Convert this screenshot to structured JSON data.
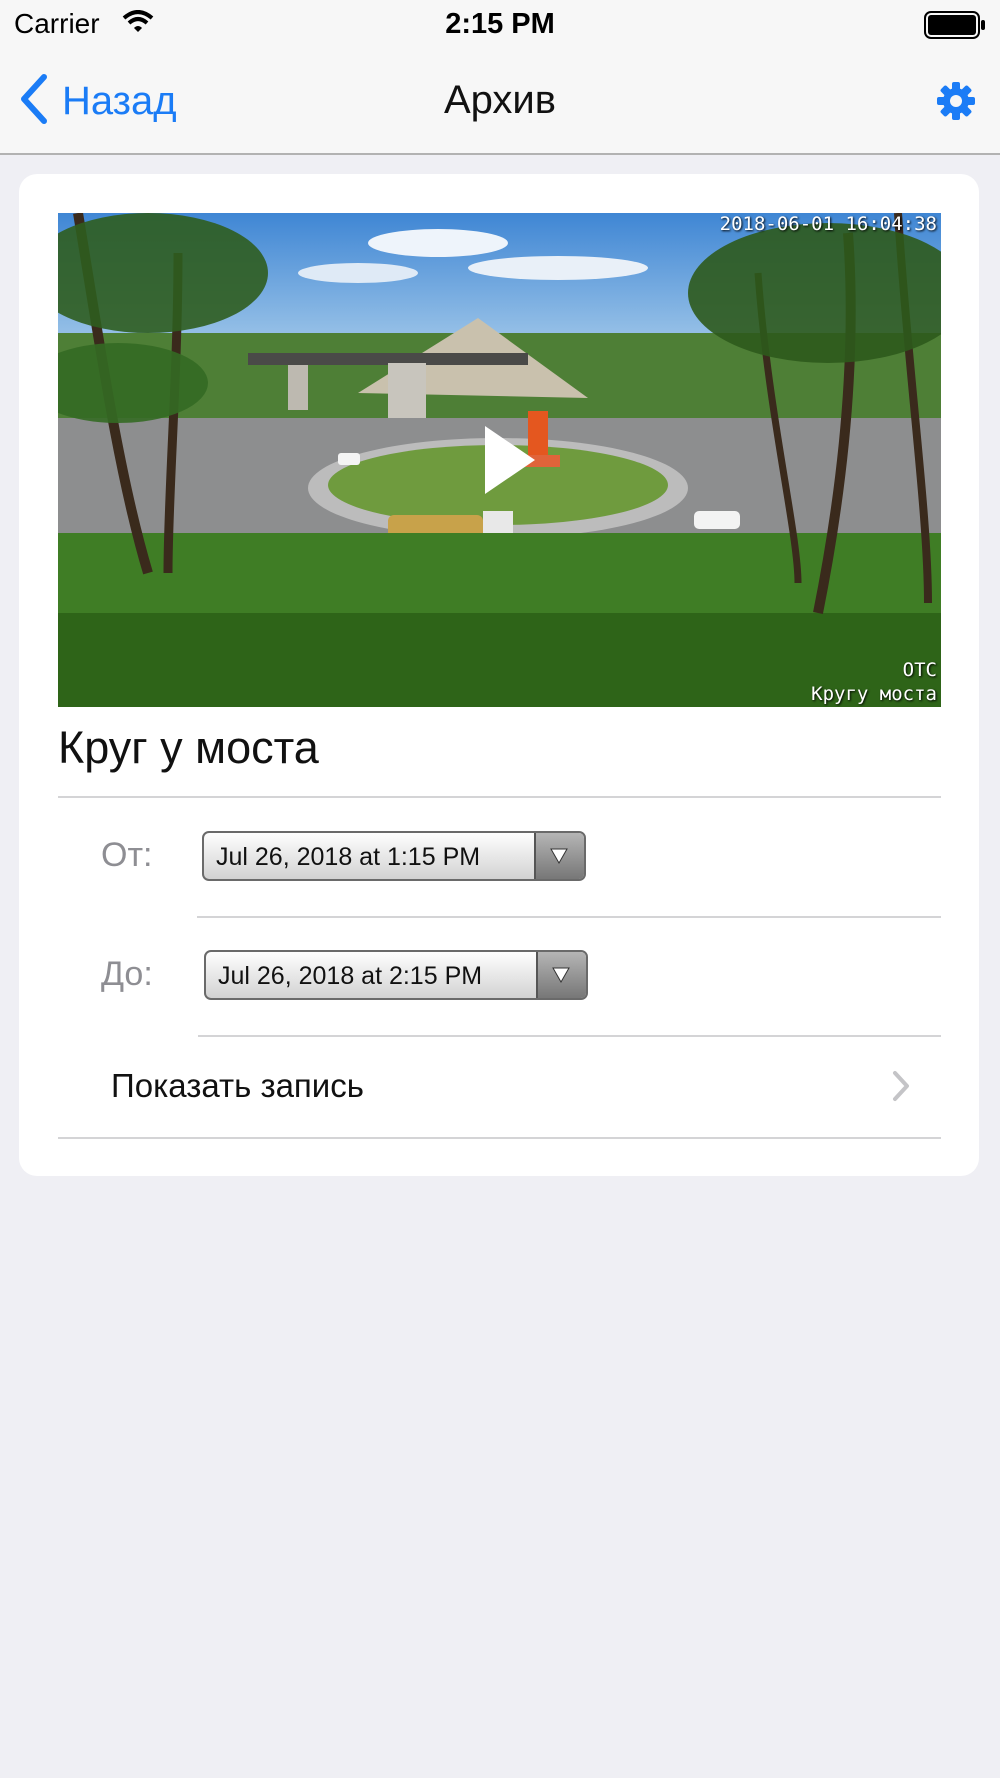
{
  "status_bar": {
    "carrier": "Carrier",
    "time": "2:15 PM"
  },
  "nav": {
    "back_label": "Назад",
    "title": "Архив"
  },
  "video": {
    "timestamp": "2018-06-01 16:04:38",
    "watermark_line1": "ОТС",
    "watermark_line2": "Кругу моста"
  },
  "camera_title": "Круг у моста",
  "form": {
    "from_label": "От:",
    "from_value": "Jul 26, 2018 at 1:15 PM",
    "to_label": "До:",
    "to_value": "Jul 26, 2018 at 2:15 PM",
    "show_record_label": "Показать запись"
  },
  "colors": {
    "accent": "#1b7cf6",
    "background": "#efeff4"
  }
}
